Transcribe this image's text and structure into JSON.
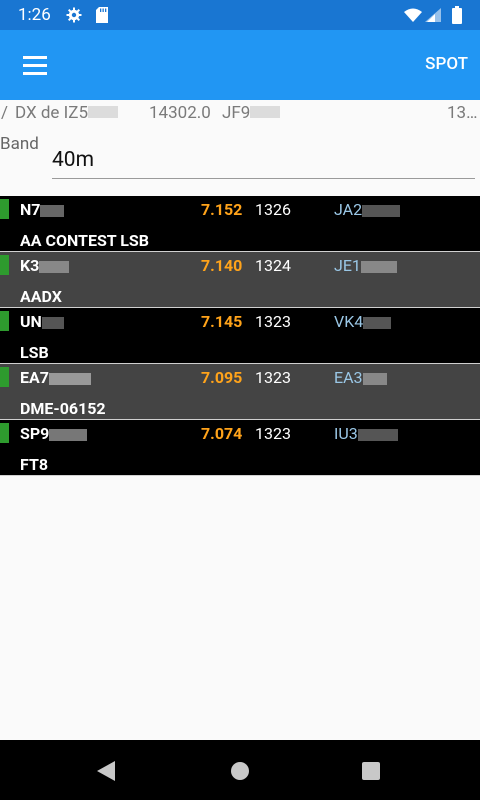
{
  "status_bar": {
    "time": "1:26",
    "icons": [
      "gear-icon",
      "sd-card-icon",
      "wifi-icon",
      "signal-icon",
      "battery-icon"
    ]
  },
  "toolbar": {
    "menu_icon": "hamburger-menu-icon",
    "spot_label": "SPOT"
  },
  "spot_header": {
    "prefix": "/",
    "dx_de": "DX de IZ5",
    "colon": ":",
    "frequency": "14302.0",
    "locator": "JF9",
    "time": "13…"
  },
  "band": {
    "label": "Band",
    "value": "40m"
  },
  "spots": [
    {
      "call": "N7",
      "freq": "7.152",
      "time": "1326",
      "spotter": "JA2",
      "comment": "AA CONTEST LSB"
    },
    {
      "call": "K3",
      "freq": "7.140",
      "time": "1324",
      "spotter": "JE1",
      "comment": "AADX"
    },
    {
      "call": "UN",
      "freq": "7.145",
      "time": "1323",
      "spotter": "VK4",
      "comment": "LSB"
    },
    {
      "call": "EA7",
      "freq": "7.095",
      "time": "1323",
      "spotter": "EA3",
      "comment": "DME-06152"
    },
    {
      "call": "SP9",
      "freq": "7.074",
      "time": "1323",
      "spotter": "IU3",
      "comment": "FT8"
    }
  ],
  "nav_bar": {
    "icons": [
      "back-icon",
      "home-icon",
      "recents-icon"
    ]
  },
  "colors": {
    "status_bar": "#1976d2",
    "toolbar": "#2196f3",
    "frequency": "#ffa31a",
    "spotter": "#9ac7e6",
    "marker": "#2e9b2e",
    "row_dark": "#000000",
    "row_alt": "#444444"
  }
}
